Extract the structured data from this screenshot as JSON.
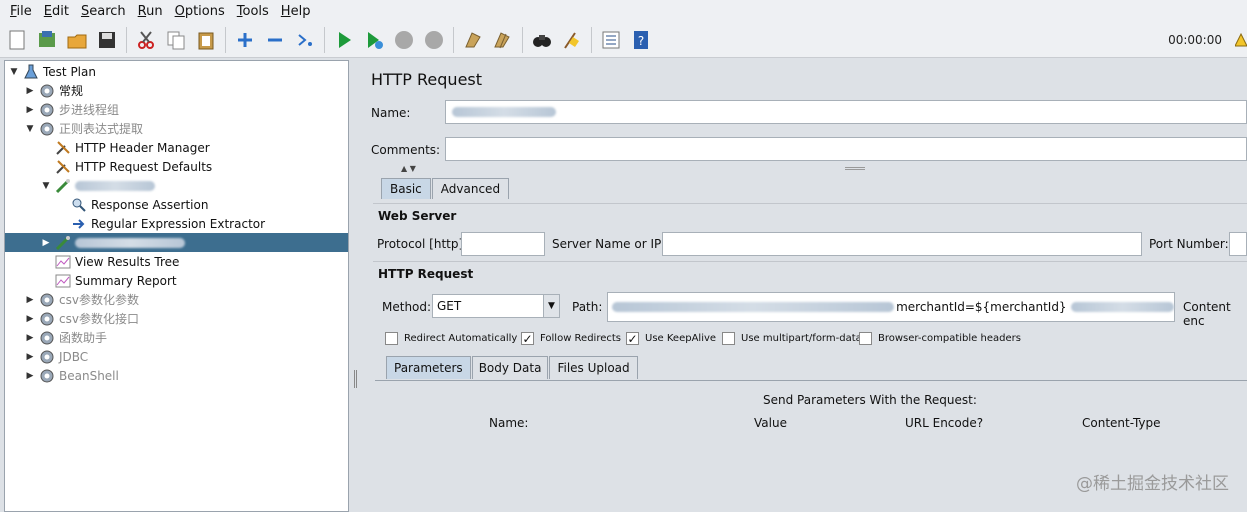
{
  "menu": {
    "items": [
      {
        "u": "F",
        "rest": "ile"
      },
      {
        "u": "E",
        "rest": "dit"
      },
      {
        "u": "S",
        "rest": "earch"
      },
      {
        "u": "R",
        "rest": "un"
      },
      {
        "u": "O",
        "rest": "ptions"
      },
      {
        "u": "T",
        "rest": "ools"
      },
      {
        "u": "H",
        "rest": "elp"
      }
    ]
  },
  "toolbar": {
    "timer": "00:00:00",
    "icons": [
      "new-icon",
      "templates-icon",
      "open-icon",
      "save-icon",
      "cut-icon",
      "copy-icon",
      "paste-icon",
      "expand-icon",
      "collapse-icon",
      "toggle-icon",
      "start-icon",
      "start-no-pauses-icon",
      "stop-icon",
      "shutdown-icon",
      "clear-icon",
      "clear-all-icon",
      "search-icon",
      "reset-search-icon",
      "function-helper-icon",
      "help-icon"
    ]
  },
  "tree": {
    "nodes": [
      {
        "label": "Test Plan",
        "arrow": "▼",
        "icon": "flask-icon",
        "level": 0,
        "dim": false,
        "selected": false,
        "blur": 0
      },
      {
        "label": "常规",
        "arrow": "▶",
        "icon": "gear-icon",
        "level": 1,
        "dim": false,
        "selected": false,
        "blur": 0
      },
      {
        "label": "步进线程组",
        "arrow": "▶",
        "icon": "gear-icon",
        "level": 1,
        "dim": true,
        "selected": false,
        "blur": 0
      },
      {
        "label": "正则表达式提取",
        "arrow": "▼",
        "icon": "gear-icon",
        "level": 1,
        "dim": true,
        "selected": false,
        "blur": 0
      },
      {
        "label": "HTTP Header Manager",
        "arrow": "",
        "icon": "wrench-icon",
        "level": 2,
        "dim": false,
        "selected": false,
        "blur": 0
      },
      {
        "label": "HTTP Request Defaults",
        "arrow": "",
        "icon": "wrench-icon",
        "level": 2,
        "dim": false,
        "selected": false,
        "blur": 0
      },
      {
        "label": "",
        "arrow": "▼",
        "icon": "sampler-icon",
        "level": 2,
        "dim": false,
        "selected": false,
        "blur": 80
      },
      {
        "label": "Response Assertion",
        "arrow": "",
        "icon": "magnifier-icon",
        "level": 3,
        "dim": false,
        "selected": false,
        "blur": 0
      },
      {
        "label": "Regular Expression Extractor",
        "arrow": "",
        "icon": "extractor-icon",
        "level": 3,
        "dim": false,
        "selected": false,
        "blur": 0
      },
      {
        "label": "",
        "arrow": "▶",
        "icon": "sampler-icon",
        "level": 2,
        "dim": false,
        "selected": true,
        "blur": 110
      },
      {
        "label": "View Results Tree",
        "arrow": "",
        "icon": "graph-icon",
        "level": 2,
        "dim": false,
        "selected": false,
        "blur": 0
      },
      {
        "label": "Summary Report",
        "arrow": "",
        "icon": "graph-icon",
        "level": 2,
        "dim": false,
        "selected": false,
        "blur": 0
      },
      {
        "label": "csv参数化参数",
        "arrow": "▶",
        "icon": "gear-icon",
        "level": 1,
        "dim": true,
        "selected": false,
        "blur": 0
      },
      {
        "label": "csv参数化接口",
        "arrow": "▶",
        "icon": "gear-icon",
        "level": 1,
        "dim": true,
        "selected": false,
        "blur": 0
      },
      {
        "label": "函数助手",
        "arrow": "▶",
        "icon": "gear-icon",
        "level": 1,
        "dim": true,
        "selected": false,
        "blur": 0
      },
      {
        "label": "JDBC",
        "arrow": "▶",
        "icon": "gear-icon",
        "level": 1,
        "dim": true,
        "selected": false,
        "blur": 0
      },
      {
        "label": "BeanShell",
        "arrow": "▶",
        "icon": "gear-icon",
        "level": 1,
        "dim": true,
        "selected": false,
        "blur": 0
      }
    ]
  },
  "panel": {
    "title": "HTTP Request",
    "name_label": "Name:",
    "comments_label": "Comments:",
    "tabs": [
      "Basic",
      "Advanced"
    ],
    "web_server": {
      "section": "Web Server",
      "protocol_label": "Protocol [http]:",
      "server_label": "Server Name or IP:",
      "port_label": "Port Number:"
    },
    "http_request": {
      "section": "HTTP Request",
      "method_label": "Method:",
      "method_value": "GET",
      "path_label": "Path:",
      "path_visible": "merchantId=${merchantId}",
      "content_encoding_label": "Content enc"
    },
    "checkboxes": [
      {
        "label": "Redirect Automatically",
        "checked": false
      },
      {
        "label": "Follow Redirects",
        "checked": true
      },
      {
        "label": "Use KeepAlive",
        "checked": true
      },
      {
        "label": "Use multipart/form-data",
        "checked": false
      },
      {
        "label": "Browser-compatible headers",
        "checked": false
      }
    ],
    "subtabs": [
      "Parameters",
      "Body Data",
      "Files Upload"
    ],
    "params": {
      "heading": "Send Parameters With the Request:",
      "columns": [
        "Name:",
        "Value",
        "URL Encode?",
        "Content-Type"
      ]
    }
  },
  "watermark": "@稀土掘金技术社区"
}
